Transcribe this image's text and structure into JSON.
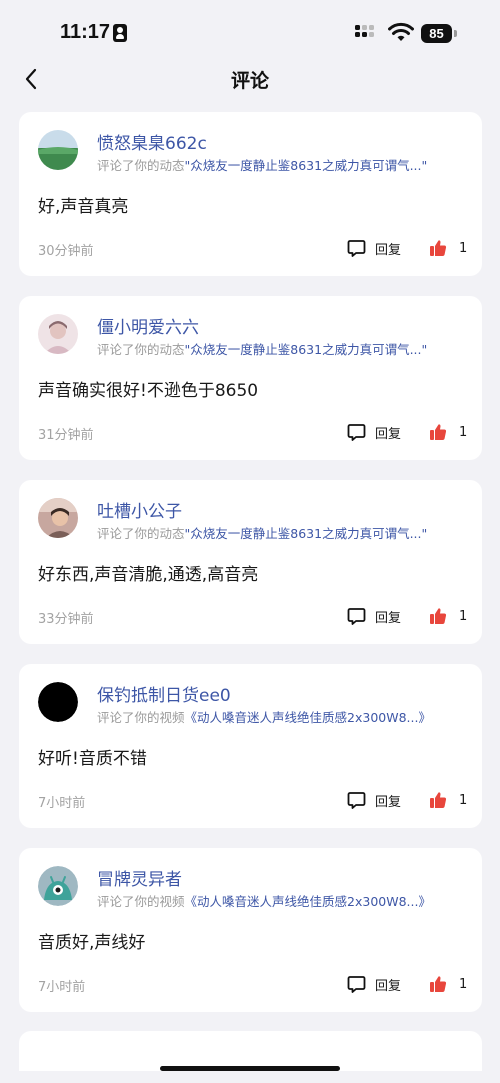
{
  "status_bar": {
    "time": "11:17",
    "battery": "85"
  },
  "nav": {
    "title": "评论"
  },
  "comments": [
    {
      "username": "愤怒臬臬662c",
      "prefix": "评论了你的动态",
      "target": "\"众烧友一度静止鉴8631之威力真可谓气...\"",
      "text": "好,声音真亮",
      "time_ago": "30分钟前",
      "reply_label": "回复",
      "likes": "1",
      "avatar": "landscape"
    },
    {
      "username": "僵小明爱六六",
      "prefix": "评论了你的动态",
      "target": "\"众烧友一度静止鉴8631之威力真可谓气...\"",
      "text": "声音确实很好!不逊色于8650",
      "time_ago": "31分钟前",
      "reply_label": "回复",
      "likes": "1",
      "avatar": "portrait"
    },
    {
      "username": "吐槽小公子",
      "prefix": "评论了你的动态",
      "target": "\"众烧友一度静止鉴8631之威力真可谓气...\"",
      "text": "好东西,声音清脆,通透,高音亮",
      "time_ago": "33分钟前",
      "reply_label": "回复",
      "likes": "1",
      "avatar": "person"
    },
    {
      "username": "保钓抵制日货ee0",
      "prefix": "评论了你的视频",
      "target": "《动人嗓音迷人声线绝佳质感2x300W8...》",
      "text": "好听!音质不错",
      "time_ago": "7小时前",
      "reply_label": "回复",
      "likes": "1",
      "avatar": "black"
    },
    {
      "username": "冒牌灵异者",
      "prefix": "评论了你的视频",
      "target": "《动人嗓音迷人声线绝佳质感2x300W8...》",
      "text": "音质好,声线好",
      "time_ago": "7小时前",
      "reply_label": "回复",
      "likes": "1",
      "avatar": "teal"
    }
  ],
  "colors": {
    "link": "#3d56a6",
    "like": "#e8463c",
    "background": "#f2f2f6"
  },
  "icons": {
    "back": "chevron-left-icon",
    "reply": "comment-bubble-icon",
    "like": "thumbs-up-icon"
  }
}
